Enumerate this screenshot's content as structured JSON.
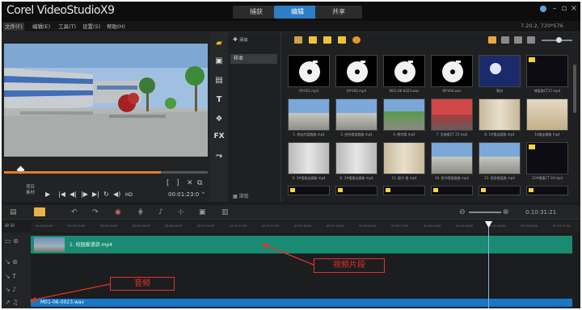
{
  "window": {
    "title": "Corel VideoStudioX9",
    "version": "7.20.2, 720*576"
  },
  "steps": [
    "捕获",
    "编辑",
    "共享"
  ],
  "menu": [
    "文件(F)",
    "编辑(E)",
    "工具(T)",
    "设置(S)",
    "帮助(H)"
  ],
  "preview": {
    "mode_labels": [
      "项目",
      "素材"
    ],
    "timecode": "00:01:23:0 ⌃",
    "controls": [
      "▶",
      "|◀",
      "◀|",
      "|▶",
      "▶|",
      "↻",
      "◀)",
      "HD"
    ],
    "clip_controls": [
      "[",
      "]",
      "✕",
      "⧉"
    ]
  },
  "library": {
    "add_label": "添加",
    "folder": "样本",
    "browse_label": "浏览",
    "view_icons": [
      "folder-icon",
      "video-icon",
      "photo-icon",
      "music-icon",
      "effect-icon"
    ],
    "items": [
      {
        "caption": "SP-V01.mp4",
        "kind": "record"
      },
      {
        "caption": "SP-V02.mp4",
        "kind": "record"
      },
      {
        "caption": "MO1-06-0023.wav",
        "kind": "record"
      },
      {
        "caption": "SP-V04.wav",
        "kind": "record"
      },
      {
        "caption": "素材",
        "kind": "sky"
      },
      {
        "caption": "博爱路CT17 mp4",
        "kind": "dark"
      },
      {
        "caption": "1. 校友的爱路路 mp4",
        "kind": "building"
      },
      {
        "caption": "2. 经纬楼爱路路 mp4",
        "kind": "building"
      },
      {
        "caption": "4. 教学楼 mp4",
        "kind": "green"
      },
      {
        "caption": "7. 学者楼CT 25 mp4",
        "kind": "red"
      },
      {
        "caption": "8. 1#楼走廊路 mp4",
        "kind": "corridor"
      },
      {
        "caption": "14楼走廊路 mp4",
        "kind": "room"
      },
      {
        "caption": "9. 3#楼楼走廊路 mp4",
        "kind": "corridor2"
      },
      {
        "caption": "8. 3#楼楼走廊路 mp4",
        "kind": "corridor2"
      },
      {
        "caption": "11. 图书 楼 mp4",
        "kind": "corridor"
      },
      {
        "caption": "10. 图书馆爱路路 mp4",
        "kind": "building"
      },
      {
        "caption": "12. 宿舍楼爱路 mp4",
        "kind": "building"
      },
      {
        "caption": "12#楼楼CT 19 mp4",
        "kind": "dark"
      }
    ]
  },
  "timeline": {
    "ruler": [
      "00:00:00:00",
      "00:00:12:00",
      "00:00:24:00",
      "00:00:36:00",
      "00:00:48:00",
      "00:01:00:00",
      "00:01:12:00",
      "00:01:24:00",
      "00:01:36:00",
      "00:01:48:00",
      "00:02:00:00",
      "00:02:12:00",
      "00:02:24:00",
      "00:02:36:00",
      "00:02:48:00",
      "00:03:00:00",
      "00:03:12:00"
    ],
    "zoom_timecode": "0:10:31:21",
    "video_clip": "1. 校园爱漫游.mp4",
    "audio_clip": "M01-06-0023.wav"
  },
  "annotations": {
    "video": "视频片段",
    "audio": "音频"
  },
  "colors": {
    "accent": "#2d7ec7",
    "video_track": "#1a8a72",
    "audio_track": "#1577c6",
    "annotation": "#e5332a",
    "scrubber": "#e07d2a"
  }
}
